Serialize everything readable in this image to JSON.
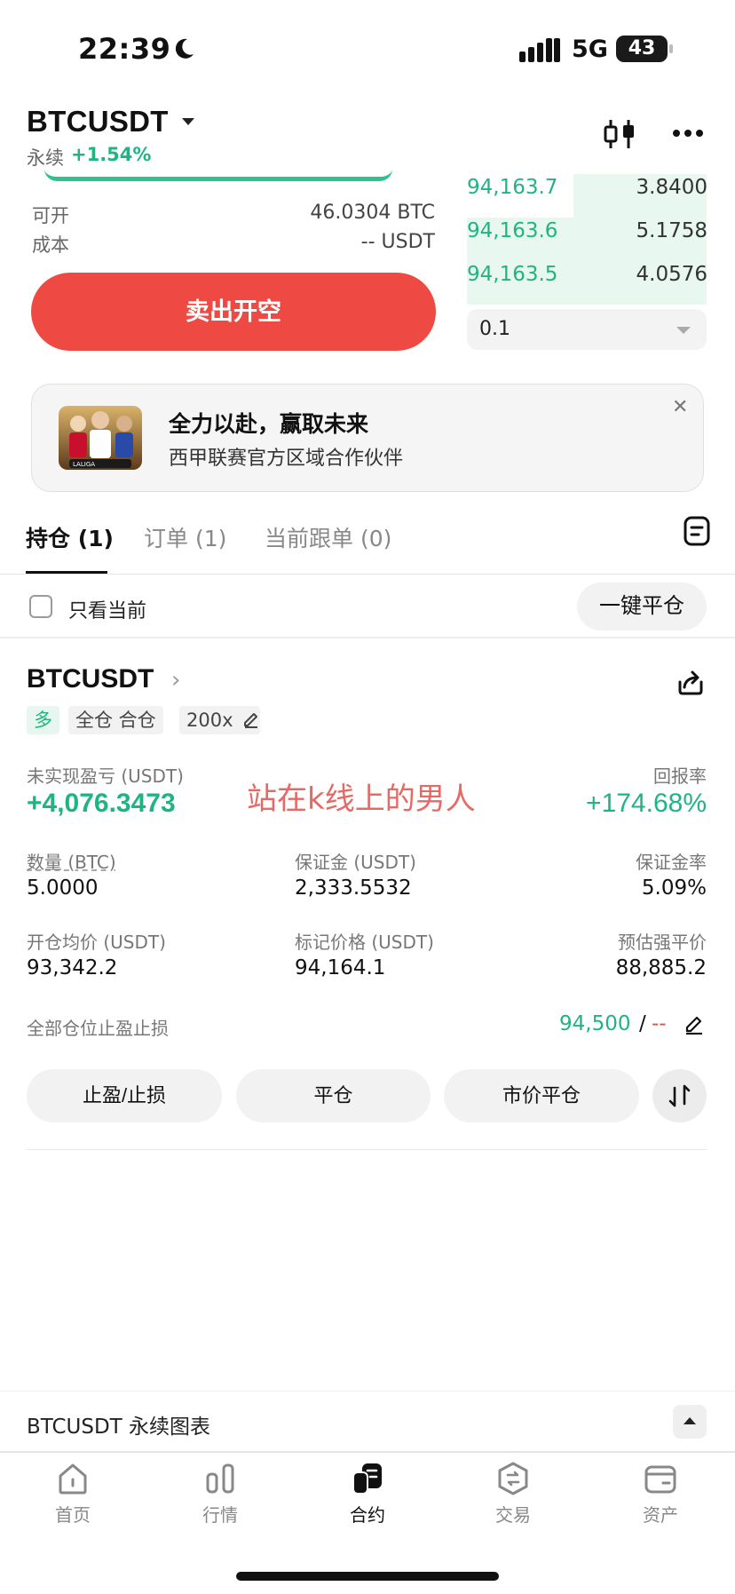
{
  "status_bar": {
    "time": "22:39",
    "network": "5G",
    "battery": "43"
  },
  "header": {
    "symbol": "BTCUSDT",
    "contract_type": "永续",
    "change": "+1.54%"
  },
  "trade_panel": {
    "available_label": "可开",
    "available_value": "46.0304 BTC",
    "cost_label": "成本",
    "cost_value": "-- USDT",
    "sell_button": "卖出开空"
  },
  "order_book": {
    "rows": [
      {
        "price": "94,163.7",
        "qty": "3.8400"
      },
      {
        "price": "94,163.6",
        "qty": "5.1758"
      },
      {
        "price": "94,163.5",
        "qty": "4.0576"
      }
    ],
    "depth_value": "0.1"
  },
  "banner": {
    "title": "全力以赴，赢取未来",
    "subtitle": "西甲联赛官方区域合作伙伴",
    "image_text": "LALIGA"
  },
  "tabs": [
    {
      "label": "持仓 (1)"
    },
    {
      "label": "订单 (1)"
    },
    {
      "label": "当前跟单 (0)"
    }
  ],
  "filter": {
    "only_current_label": "只看当前",
    "close_all_button": "一键平仓"
  },
  "position": {
    "symbol": "BTCUSDT",
    "tags": {
      "side": "多",
      "mode": "全仓 合仓",
      "leverage": "200x"
    },
    "unrealized_pnl_label": "未实现盈亏 (USDT)",
    "unrealized_pnl_value": "+4,076.3473",
    "roe_label": "回报率",
    "roe_value": "+174.68%",
    "watermark": "站在k线上的男人",
    "metrics": [
      {
        "label": "数量 (BTC)",
        "value": "5.0000"
      },
      {
        "label": "保证金 (USDT)",
        "value": "2,333.5532"
      },
      {
        "label": "保证金率",
        "value": "5.09%"
      },
      {
        "label": "开仓均价 (USDT)",
        "value": "93,342.2"
      },
      {
        "label": "标记价格 (USDT)",
        "value": "94,164.1"
      },
      {
        "label": "预估强平价",
        "value": "88,885.2"
      }
    ],
    "tpsl_label": "全部仓位止盈止损",
    "tp_value": "94,500",
    "tpsl_separator": "/",
    "sl_value": "--",
    "buttons": {
      "tpsl": "止盈/止损",
      "close": "平仓",
      "market_close": "市价平仓"
    }
  },
  "chart_bar": {
    "label": "BTCUSDT 永续图表"
  },
  "nav": [
    {
      "label": "首页",
      "icon": "home-icon"
    },
    {
      "label": "行情",
      "icon": "market-icon"
    },
    {
      "label": "合约",
      "icon": "futures-icon",
      "active": true
    },
    {
      "label": "交易",
      "icon": "trade-icon"
    },
    {
      "label": "资产",
      "icon": "wallet-icon"
    }
  ],
  "colors": {
    "green": "#20b483",
    "red": "#ee4a43"
  }
}
